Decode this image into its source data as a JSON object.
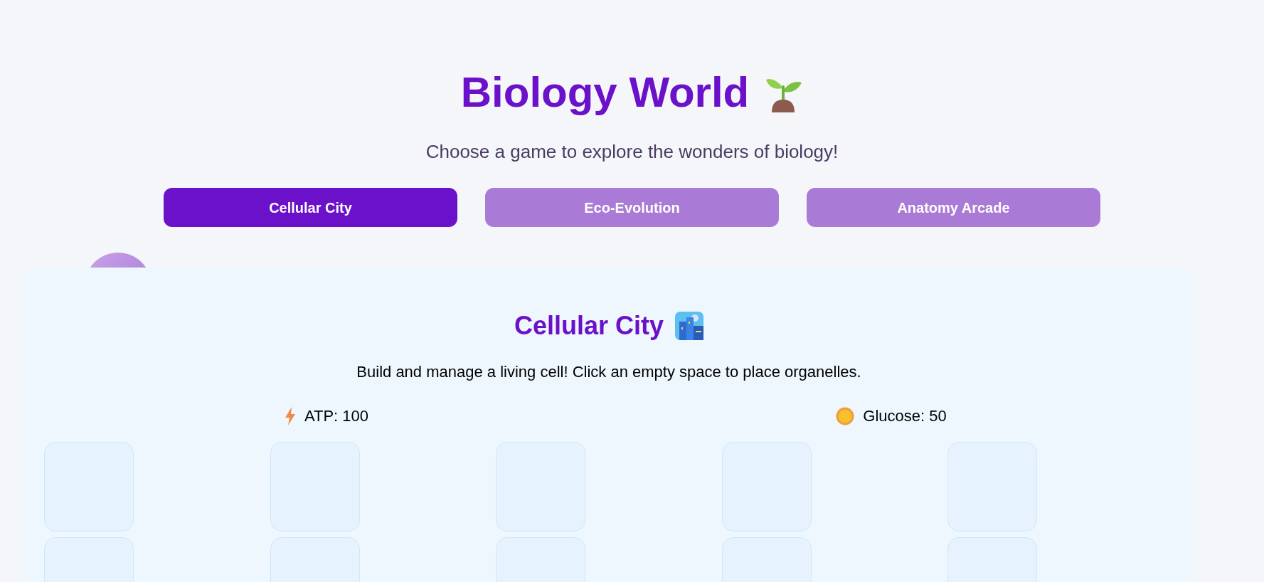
{
  "header": {
    "title": "Biology World",
    "subtitle": "Choose a game to explore the wonders of biology!"
  },
  "tabs": [
    {
      "label": "Cellular City",
      "selected": true
    },
    {
      "label": "Eco-Evolution",
      "selected": false
    },
    {
      "label": "Anatomy Arcade",
      "selected": false
    }
  ],
  "game": {
    "title": "Cellular City",
    "description": "Build and manage a living cell! Click an empty space to place organelles.",
    "stats": [
      {
        "kind": "atp",
        "label": "ATP: 100"
      },
      {
        "kind": "glucose",
        "label": "Glucose: 50"
      }
    ],
    "cells": [
      {
        "kind": "empty"
      },
      {
        "kind": "empty"
      },
      {
        "kind": "empty"
      },
      {
        "kind": "empty"
      },
      {
        "kind": "empty"
      },
      {
        "kind": "empty"
      },
      {
        "kind": "empty"
      },
      {
        "kind": "empty"
      },
      {
        "kind": "empty"
      },
      {
        "kind": "empty"
      }
    ]
  }
}
